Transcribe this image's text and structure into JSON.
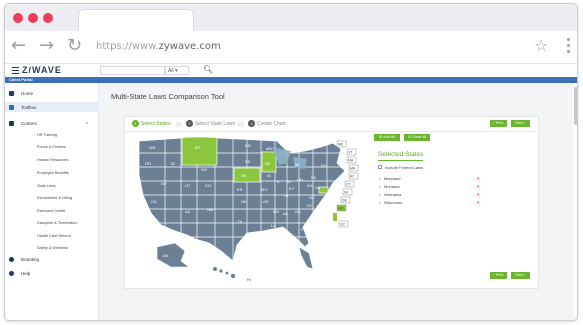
{
  "browser": {
    "url_prefix": "https://www.",
    "url_domain": "zywave.com",
    "traffic_dot_color": "#ef3c5a"
  },
  "app": {
    "logo": "Z/WAVE",
    "search_select": "All",
    "portal_label": "Client Portal"
  },
  "sidebar": {
    "items": [
      {
        "label": "Home",
        "icon": "home-icon"
      },
      {
        "label": "Toolbox",
        "icon": "toolbox-icon"
      },
      {
        "label": "Content",
        "icon": "content-icon"
      },
      {
        "label": "Branding",
        "icon": "branding-icon"
      },
      {
        "label": "Help",
        "icon": "help-icon"
      }
    ],
    "subitems": [
      "HR Training",
      "Forms & Policies",
      "Human Resources",
      "Employee Benefits",
      "State Laws",
      "Recruitment & Hiring",
      "Resource Center",
      "Discipline & Termination",
      "Health Care Reform",
      "Safety & Wellness"
    ]
  },
  "main": {
    "title": "Multi-State Laws Comparison Tool",
    "steps": [
      {
        "num": "1",
        "label": "Select States"
      },
      {
        "num": "2",
        "label": "Select State Laws"
      },
      {
        "num": "3",
        "label": "Create Chart"
      }
    ],
    "prev_label": "‹ Prev",
    "next_label": "Next ›",
    "add_all_label": "⊕ Add All",
    "clear_all_label": "⊖ Clear All",
    "panel_title": "Selected States",
    "federal_label": "Include Federal Laws",
    "selected_states": [
      "Maryland",
      "Montana",
      "Nebraska",
      "Wisconsin"
    ],
    "remove_mark": "×"
  },
  "map": {
    "highlight_color": "#8cc63f",
    "base_color": "#6b7f95",
    "state_labels": [
      "WA",
      "MT",
      "ND",
      "MN",
      "OR",
      "ID",
      "SD",
      "WI",
      "WY",
      "MI",
      "NE",
      "IA",
      "NV",
      "UT",
      "CO",
      "KS",
      "MO",
      "IL",
      "IN",
      "OH",
      "PA",
      "NY",
      "CA",
      "AZ",
      "NM",
      "OK",
      "AR",
      "TN",
      "KY",
      "WV",
      "VA",
      "NC",
      "SC",
      "GA",
      "AL",
      "MS",
      "LA",
      "TX",
      "FL",
      "AK",
      "HI",
      "ME",
      "VT",
      "NH",
      "MA",
      "RI",
      "CT",
      "NJ",
      "DE",
      "MD",
      "DC"
    ],
    "highlighted": [
      "MT",
      "NE",
      "WI",
      "MD"
    ]
  }
}
